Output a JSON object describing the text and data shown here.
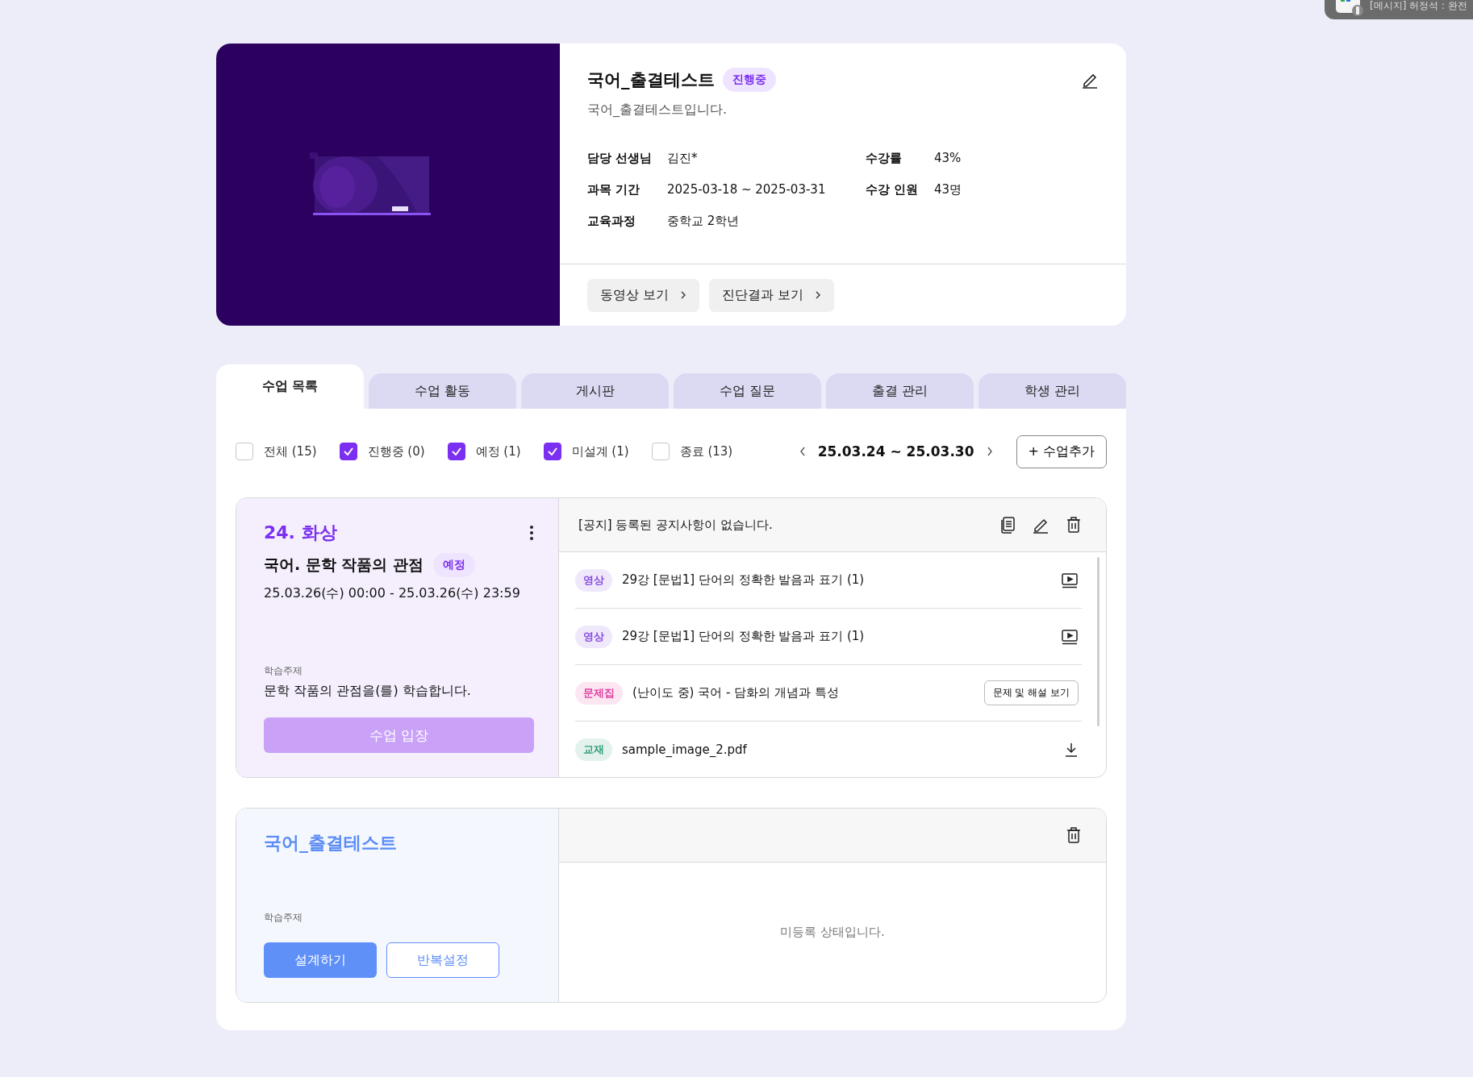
{
  "notification": {
    "text": "[메시지] 허정석 : 완전"
  },
  "course": {
    "title": "국어_출결테스트",
    "status": "진행중",
    "description": "국어_출결테스트입니다.",
    "info": [
      {
        "label": "담당 선생님",
        "value": "김진*"
      },
      {
        "label": "수강률",
        "value": "43%"
      },
      {
        "label": "과목 기간",
        "value": "2025-03-18 ~ 2025-03-31"
      },
      {
        "label": "수강 인원",
        "value": "43명"
      },
      {
        "label": "교육과정",
        "value": "중학교 2학년"
      }
    ],
    "buttons": [
      "동영상 보기",
      "진단결과 보기"
    ]
  },
  "tabs": [
    {
      "label": "수업 목록",
      "selected": true
    },
    {
      "label": "수업 활동",
      "selected": false
    },
    {
      "label": "게시판",
      "selected": false
    },
    {
      "label": "수업 질문",
      "selected": false
    },
    {
      "label": "출결 관리",
      "selected": false
    },
    {
      "label": "학생 관리",
      "selected": false
    }
  ],
  "filters": [
    {
      "label": "전체 (15)",
      "checked": false
    },
    {
      "label": "진행중 (0)",
      "checked": true
    },
    {
      "label": "예정 (1)",
      "checked": true
    },
    {
      "label": "미설계 (1)",
      "checked": true
    },
    {
      "label": "종료 (13)",
      "checked": false
    }
  ],
  "date_range": "25.03.24 ~ 25.03.30",
  "add_button": "+ 수업추가",
  "lessons": [
    {
      "kind": "scheduled",
      "number": "24. 화상",
      "subject": "국어. 문학 작품의 관점",
      "status": "예정",
      "time": "25.03.26(수) 00:00 - 25.03.26(수) 23:59",
      "topic_label": "학습주제",
      "topic": "문학 작품의 관점을(를) 학습합니다.",
      "enter_button": {
        "label": "수업 입장",
        "disabled": true
      },
      "notice": "[공지] 등록된 공지사항이 없습니다.",
      "materials": [
        {
          "kind": "video",
          "tag": "영상",
          "color": "#8a4fe0",
          "title": "29강 [문법1] 단어의 정확한 발음과 표기 (1)"
        },
        {
          "kind": "video",
          "tag": "영상",
          "color": "#8a4fe0",
          "title": "29강 [문법1] 단어의 정확한 발음과 표기 (1)"
        },
        {
          "kind": "quiz",
          "tag": "문제집",
          "color": "#e040a0",
          "title": "(난이도 중) 국어 - 담화의 개념과 특성",
          "action_label": "문제 및 해설 보기"
        },
        {
          "kind": "file",
          "tag": "교재",
          "color": "#2f9e7a",
          "title": "sample_image_2.pdf"
        }
      ]
    },
    {
      "kind": "draft",
      "title": "국어_출결테스트",
      "topic_label": "학습주제",
      "buttons": [
        "설계하기",
        "반복설정"
      ],
      "empty_text": "미등록 상태입니다."
    }
  ]
}
